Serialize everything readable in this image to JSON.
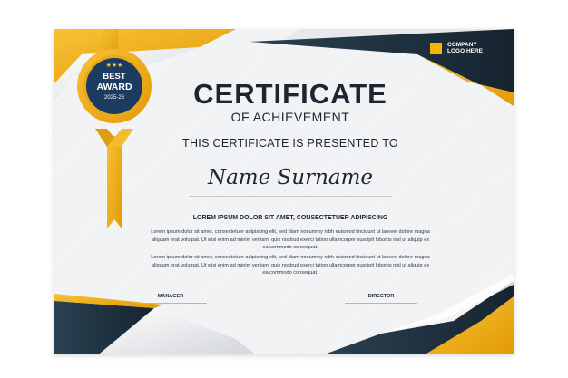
{
  "badge": {
    "stars": "★★★",
    "line1": "BEST",
    "line2": "AWARD",
    "year": "2025-26"
  },
  "logo": {
    "text": "COMPANY LOGO HERE"
  },
  "title": "CERTIFICATE",
  "subtitle": "OF ACHIEVEMENT",
  "presented": "THIS CERTIFICATE IS PRESENTED TO",
  "name": "Name Surname",
  "heading": "LOREM IPSUM DOLOR SIT AMET, CONSECTETUER ADIPISCING",
  "paragraphs": [
    "Lorem ipsum dolor sit amet, consectetuer adipiscing elit, sed diam nonummy nibh euismod tincidunt ut laoreet dolore magna aliquam erat volutpat. Ut wisi enim ad minim veniam, quis nostrud exerci tation ullamcorper suscipit lobortis nisl ut aliquip ex ea commodo consequat.",
    "Lorem ipsum dolor sit amet, consectetuer adipiscing elit, sed diam nonummy nibh euismod tincidunt ut laoreet dolore magna aliquam erat volutpat. Ut wisi enim ad minim veniam, quis nostrud exerci tation ullamcorper suscipit lobortis nisl ut aliquip ex ea commodo consequat."
  ],
  "signatures": {
    "left": "MANAGER",
    "right": "DIRECTOR"
  },
  "colors": {
    "navy": "#1e3140",
    "gold": "#f5b400",
    "text": "#1e2530"
  }
}
